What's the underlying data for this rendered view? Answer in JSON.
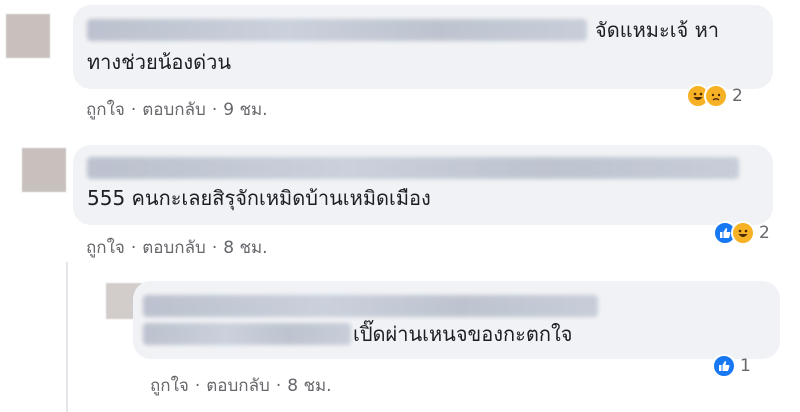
{
  "comments": [
    {
      "text_lines": [
        "จัดแหมะเจ้ หา",
        "ทางช่วยน้องด่วน"
      ],
      "like_label": "ถูกใจ",
      "reply_label": "ตอบกลับ",
      "time": "9 ชม.",
      "reactions": [
        "haha-icon",
        "sad-icon"
      ],
      "reaction_count": "2"
    },
    {
      "text_lines": [
        "555 คนกะเลยสิรุจักเหมิดบ้านเหมิดเมือง"
      ],
      "like_label": "ถูกใจ",
      "reply_label": "ตอบกลับ",
      "time": "8 ชม.",
      "reactions": [
        "like-icon",
        "haha-icon"
      ],
      "reaction_count": "2"
    },
    {
      "text_lines": [
        "เปิ๊ดผ่านเหนจของกะตกใจ"
      ],
      "like_label": "ถูกใจ",
      "reply_label": "ตอบกลับ",
      "time": "8 ชม.",
      "reactions": [
        "like-icon"
      ],
      "reaction_count": "1"
    }
  ],
  "separator": "·",
  "colors": {
    "bubble": "#f0f2f5",
    "meta": "#65676b",
    "like": "#1877f2",
    "haha": "#f7b125"
  }
}
